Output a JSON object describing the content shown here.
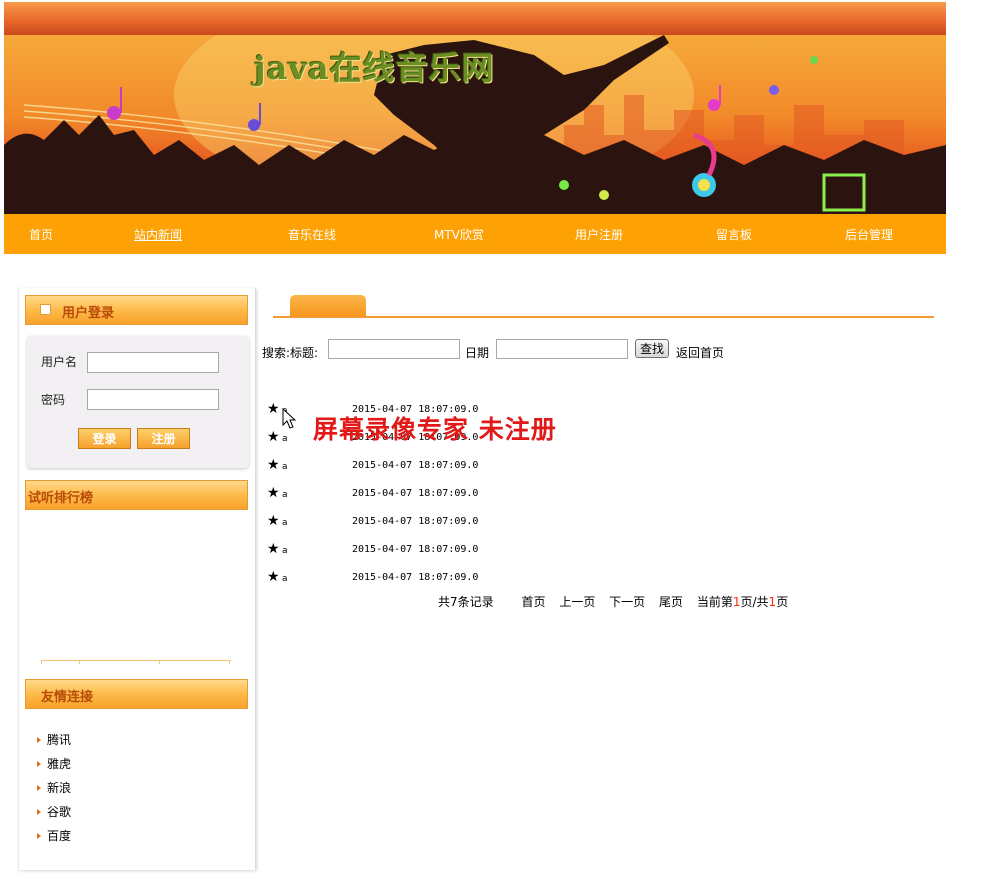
{
  "header": {
    "site_title": "java在线音乐网"
  },
  "nav": {
    "items": [
      {
        "label": "首页"
      },
      {
        "label": "站内新闻"
      },
      {
        "label": "音乐在线"
      },
      {
        "label": "MTV欣赏"
      },
      {
        "label": "用户注册"
      },
      {
        "label": "留言板"
      },
      {
        "label": "后台管理"
      }
    ]
  },
  "sidebar": {
    "login": {
      "title": "用户登录",
      "username_label": "用户名",
      "username_value": "",
      "password_label": "密码",
      "password_value": "",
      "login_button": "登录",
      "register_button": "注册"
    },
    "ranking": {
      "title": "试听排行榜"
    },
    "links": {
      "title": "友情连接",
      "items": [
        "腾讯",
        "雅虎",
        "新浪",
        "谷歌",
        "百度"
      ]
    }
  },
  "search": {
    "label": "搜索:标题:",
    "title_value": "",
    "date_label": "日期",
    "date_value": "",
    "button": "查找",
    "back_link": "返回首页"
  },
  "news": {
    "rows": [
      {
        "star": "★",
        "title": "a",
        "date": "2015-04-07 18:07:09.0"
      },
      {
        "star": "★",
        "title": "a",
        "date": "2015-04-07 18:07:09.0"
      },
      {
        "star": "★",
        "title": "a",
        "date": "2015-04-07 18:07:09.0"
      },
      {
        "star": "★",
        "title": "a",
        "date": "2015-04-07 18:07:09.0"
      },
      {
        "star": "★",
        "title": "a",
        "date": "2015-04-07 18:07:09.0"
      },
      {
        "star": "★",
        "title": "a",
        "date": "2015-04-07 18:07:09.0"
      },
      {
        "star": "★",
        "title": "a",
        "date": "2015-04-07 18:07:09.0"
      }
    ]
  },
  "pager": {
    "total": "共7条记录",
    "first": "首页",
    "prev": "上一页",
    "next": "下一页",
    "last": "尾页",
    "current_prefix": "当前第",
    "current_page": "1",
    "current_mid": "页/共",
    "total_pages": "1",
    "current_suffix": "页"
  },
  "overlay": {
    "watermark": "屏幕录像专家  未注册"
  },
  "colors": {
    "nav_bg": "#fea104",
    "accent": "#f29a2e",
    "header_text": "#b94a08",
    "watermark": "#e11919",
    "pager_number": "#ff2a00"
  }
}
